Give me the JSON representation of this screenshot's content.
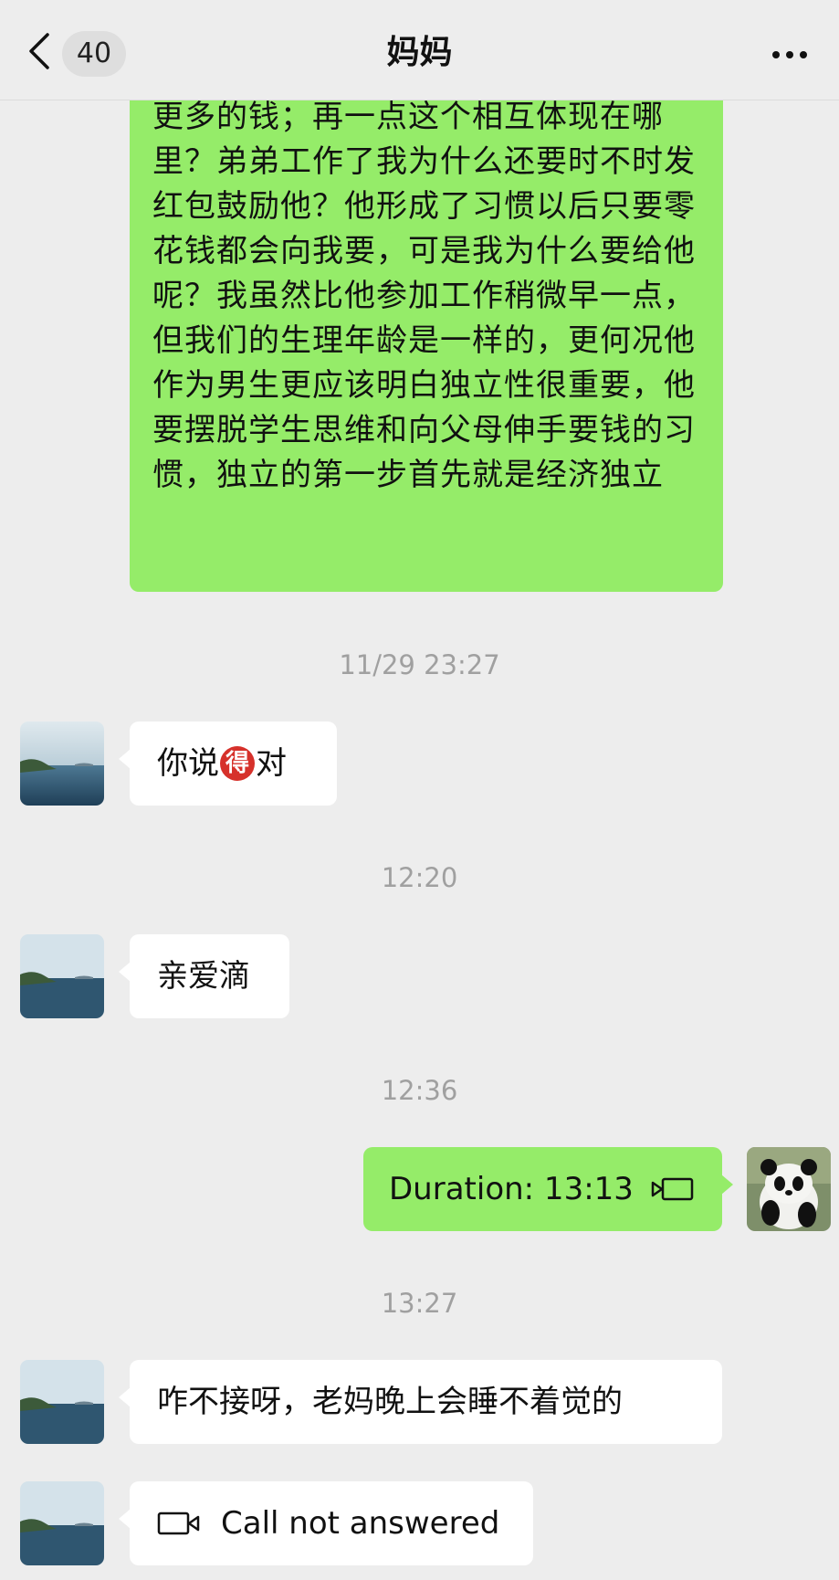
{
  "header": {
    "unread_count": "40",
    "title": "妈妈"
  },
  "messages": {
    "long_text": "更多的钱；再一点这个相互体现在哪里？弟弟工作了我为什么还要时不时发红包鼓励他？他形成了习惯以后只要零花钱都会向我要，可是我为什么要给他呢？我虽然比他参加工作稍微早一点，但我们的生理年龄是一样的，更何况他作为男生更应该明白独立性很重要，他要摆脱学生思维和向父母伸手要钱的习惯，独立的第一步首先就是经济独立",
    "ts1": "11/29 23:27",
    "msg1_before": "你说",
    "msg1_emoji": "得",
    "msg1_after": "对",
    "ts2": "12:20",
    "msg2": "亲爱滴",
    "ts3": "12:36",
    "call_duration": "Duration: 13:13",
    "ts4": "13:27",
    "msg3": "咋不接呀，老妈晚上会睡不着觉的",
    "call_missed": "Call not answered"
  },
  "colors": {
    "background": "#ededed",
    "sent_bubble": "#95ec69",
    "received_bubble": "#ffffff",
    "timestamp": "#a0a0a0"
  },
  "icons": {
    "back": "chevron-left-icon",
    "more": "more-dots-icon",
    "video_call": "video-camera-icon"
  }
}
